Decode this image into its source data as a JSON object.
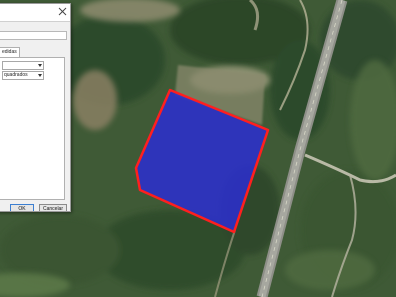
{
  "map": {
    "base_color": "#3f5a36",
    "polygon_fill": "#2c2ed1",
    "polygon_stroke": "#ff1f1f"
  },
  "dialog": {
    "tab_label": "edidas",
    "select_1_value": "",
    "select_2_value": "quadrados",
    "ok_label": "OK",
    "cancel_label": "Cancelar"
  }
}
